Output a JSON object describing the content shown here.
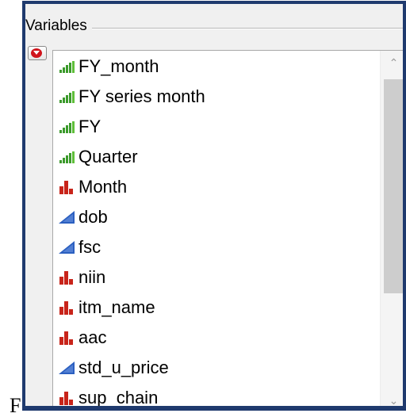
{
  "outside_text": "F",
  "panel": {
    "title": "Variables",
    "menu_icon": "red-circle-triangle-down-icon"
  },
  "list": {
    "items": [
      {
        "label": "FY_month",
        "type": "ordinal"
      },
      {
        "label": "FY series month",
        "type": "ordinal"
      },
      {
        "label": "FY",
        "type": "ordinal"
      },
      {
        "label": "Quarter",
        "type": "ordinal"
      },
      {
        "label": "Month",
        "type": "nominal"
      },
      {
        "label": "dob",
        "type": "continuous"
      },
      {
        "label": "fsc",
        "type": "continuous"
      },
      {
        "label": "niin",
        "type": "nominal"
      },
      {
        "label": "itm_name",
        "type": "nominal"
      },
      {
        "label": "aac",
        "type": "nominal"
      },
      {
        "label": "std_u_price",
        "type": "continuous"
      },
      {
        "label": "sup_chain",
        "type": "nominal"
      }
    ]
  },
  "scrollbar": {
    "up_icon": "chevron-up-icon",
    "down_icon": "chevron-down-icon"
  },
  "colors": {
    "frame_border": "#1f3a6e",
    "ordinal_icon": "#3b9a2b",
    "nominal_icon": "#c8241a",
    "continuous_icon": "#2b5fc0"
  }
}
